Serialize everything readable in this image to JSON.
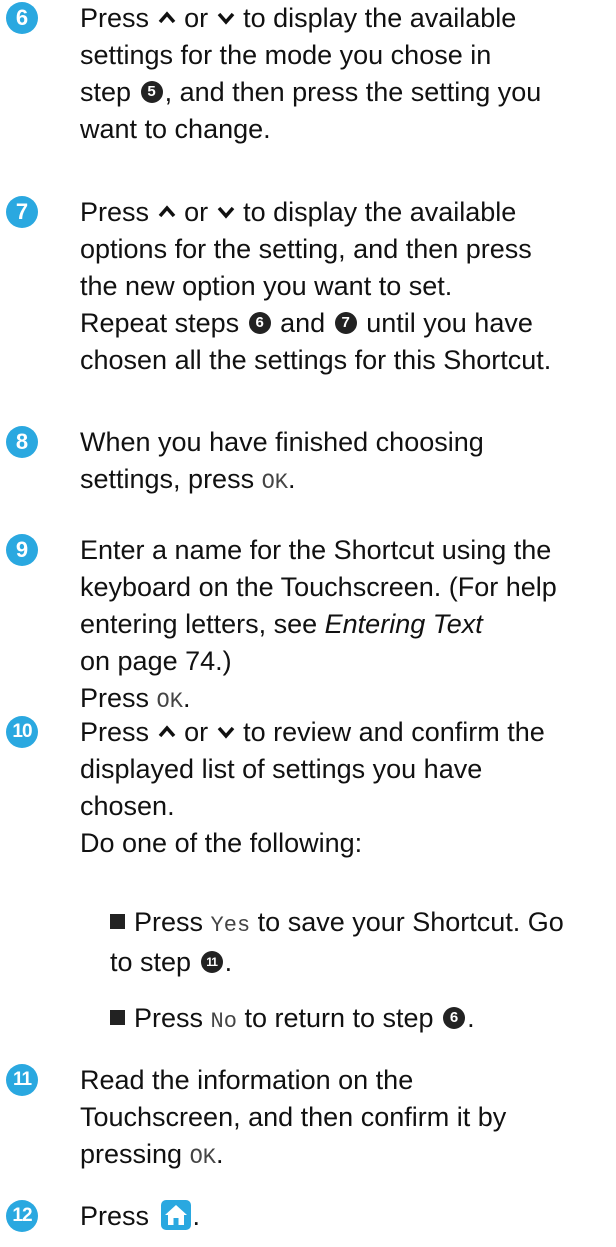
{
  "colors": {
    "step_badge": "#2aa8e0",
    "ref_badge": "#222222"
  },
  "icons": [
    "up-arrow-icon",
    "down-arrow-icon",
    "home-icon",
    "bullet-square-icon"
  ],
  "steps": {
    "s6": {
      "number": "6",
      "l1_a": "Press",
      "l1_b": "or",
      "l1_c": "to display the available",
      "l2": "settings for the mode you chose in",
      "l3_a": "step",
      "l3_ref": "5",
      "l3_b": ", and then press the setting you",
      "l4": "want to change."
    },
    "s7": {
      "number": "7",
      "l1_a": "Press",
      "l1_b": "or",
      "l1_c": "to display the available",
      "l2": "options for the setting, and then press",
      "l3": "the new option you want to set.",
      "l4_a": "Repeat steps",
      "l4_ref1": "6",
      "l4_b": "and",
      "l4_ref2": "7",
      "l4_c": "until you have",
      "l5": "chosen all the settings for this Shortcut."
    },
    "s8": {
      "number": "8",
      "l1": "When you have finished choosing",
      "l2_a": "settings, press",
      "l2_ok": "OK",
      "l2_b": "."
    },
    "s9": {
      "number": "9",
      "l1": "Enter a name for the Shortcut using the",
      "l2": "keyboard on the Touchscreen. (For help",
      "l3_a": "entering letters, see",
      "l3_link": "Entering Text",
      "l4": "on page 74.)",
      "l5_a": "Press",
      "l5_ok": "OK",
      "l5_b": "."
    },
    "s10": {
      "number": "10",
      "l1_a": "Press",
      "l1_b": "or",
      "l1_c": "to review and confirm the",
      "l2": "displayed list of settings you have",
      "l3": "chosen.",
      "l4": "Do one of the following:",
      "b1_a": "Press",
      "b1_yes": "Yes",
      "b1_b": "to save your Shortcut. Go",
      "b1_c": "to step",
      "b1_ref": "11",
      "b1_d": ".",
      "b2_a": "Press",
      "b2_no": "No",
      "b2_b": "to return to step",
      "b2_ref": "6",
      "b2_c": "."
    },
    "s11": {
      "number": "11",
      "l1": "Read the information on the",
      "l2": "Touchscreen, and then confirm it by",
      "l3_a": "pressing",
      "l3_ok": "OK",
      "l3_b": "."
    },
    "s12": {
      "number": "12",
      "l1_a": "Press",
      "l1_b": "."
    }
  }
}
